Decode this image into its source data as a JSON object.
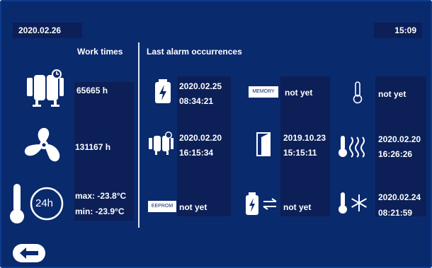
{
  "date": "2020.02.26",
  "time": "15:09",
  "work_times": {
    "header": "Work times",
    "compressor_hours": "65665 h",
    "fan_hours": "131167 h",
    "temp_max": "max: -23.8°C",
    "temp_min": "min: -23.9°C",
    "period_label": "24h"
  },
  "alarms": {
    "header": "Last alarm occurrences",
    "power": {
      "date": "2020.02.25",
      "time": "08:34:21"
    },
    "memory": {
      "label": "MEMORY",
      "value": "not yet"
    },
    "sensor": {
      "value": "not yet"
    },
    "compressor": {
      "date": "2020.02.20",
      "time": "16:15:34"
    },
    "door": {
      "date": "2019.10.23",
      "time": "15:15:11"
    },
    "high_temp": {
      "date": "2020.02.20",
      "time": "16:26:26"
    },
    "eeprom": {
      "label": "EEPROM",
      "value": "not yet"
    },
    "power_comm": {
      "value": "not yet"
    },
    "low_temp": {
      "date": "2020.02.24",
      "time": "08:21:59"
    }
  },
  "colors": {
    "background": "#0a2a6e",
    "panel": "#0c1f57",
    "icon": "#ffffff"
  }
}
